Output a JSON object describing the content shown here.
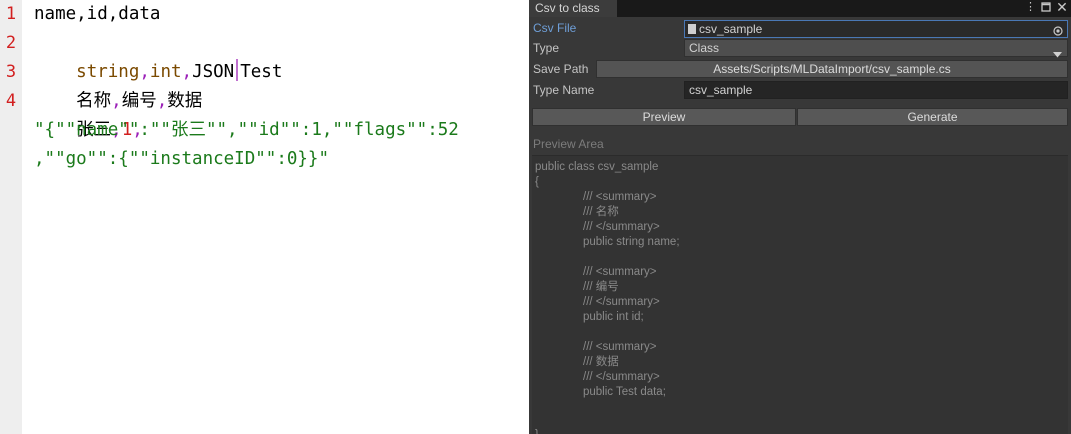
{
  "editor": {
    "line_numbers": [
      "1",
      "2",
      "3",
      "4"
    ],
    "line1": "name,id,data",
    "line2": {
      "t1": "string",
      "c1": ",",
      "t2": "int",
      "c2": ",",
      "t3": "JSON",
      "t4": "Test"
    },
    "line3": {
      "t1": "名称",
      "c1": ",",
      "t2": "编号",
      "c2": ",",
      "t3": "数据"
    },
    "line4": {
      "t1": "张三",
      "c1": ",",
      "t2": "1",
      "c2": ","
    },
    "line4_wrap1": "\"{\"\"name\"\":\"\"张三\"\",\"\"id\"\":1,\"\"flags\"\":52",
    "line4_wrap2": ",\"\"go\"\":{\"\"instanceID\"\":0}}\""
  },
  "panel": {
    "tab_title": "Csv to class",
    "window_icons": [
      "kebab-menu-icon",
      "maximize-icon",
      "close-icon"
    ],
    "csv_file": {
      "label": "Csv File",
      "value": "csv_sample"
    },
    "type": {
      "label": "Type",
      "value": "Class"
    },
    "save_path": {
      "label": "Save Path",
      "value": "Assets/Scripts/MLDataImport/csv_sample.cs"
    },
    "type_name": {
      "label": "Type Name",
      "value": "csv_sample"
    },
    "preview_button": "Preview",
    "generate_button": "Generate",
    "preview_header": "Preview Area",
    "preview_lines": [
      "public class csv_sample",
      "{",
      "/// <summary>",
      "/// 名称",
      "/// </summary>",
      "public string name;",
      "",
      "/// <summary>",
      "/// 编号",
      "/// </summary>",
      "public int id;",
      "",
      "/// <summary>",
      "/// 数据",
      "/// </summary>",
      "public Test data;",
      "",
      "",
      "}"
    ],
    "colors": {
      "accent_label": "#6f9fd8",
      "panel_bg": "#383838",
      "field_bg": "#2a2a2a"
    }
  }
}
